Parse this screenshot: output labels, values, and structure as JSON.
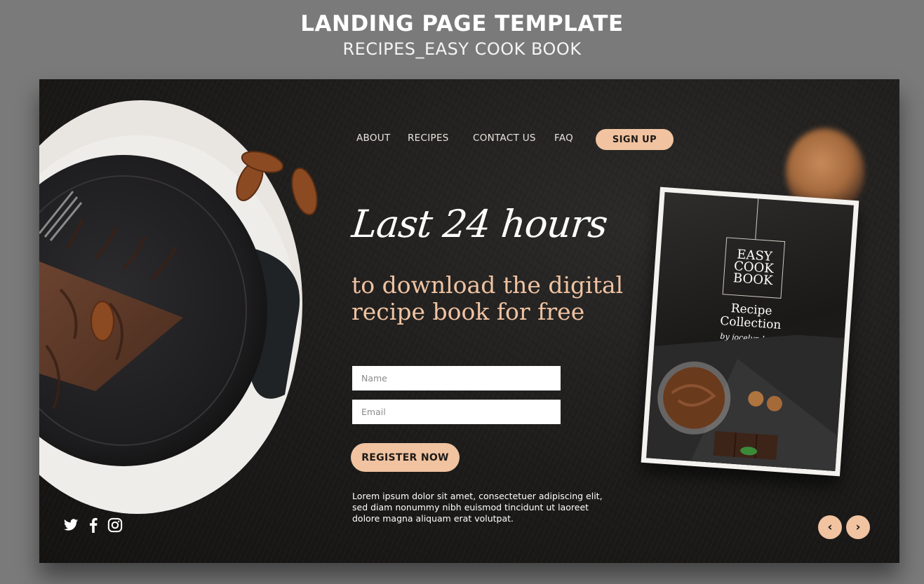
{
  "frame": {
    "title": "LANDING PAGE TEMPLATE",
    "subtitle": "RECIPES_EASY COOK BOOK"
  },
  "nav": {
    "items": [
      {
        "label": "ABOUT"
      },
      {
        "label": "RECIPES"
      },
      {
        "label": "CONTACT US"
      },
      {
        "label": "FAQ"
      }
    ],
    "signup_label": "SIGN UP"
  },
  "hero": {
    "script_title": "Last 24 hours",
    "subtitle_line1": "to download the digital",
    "subtitle_line2": "recipe book for free"
  },
  "form": {
    "name_placeholder": "Name",
    "email_placeholder": "Email",
    "register_label": "REGISTER NOW"
  },
  "body_text": "Lorem ipsum dolor sit amet, consectetuer adipiscing elit, sed diam nonummy nibh euismod tincidunt ut laoreet dolore magna aliquam erat volutpat.",
  "social": {
    "icons": [
      "twitter-icon",
      "facebook-icon",
      "instagram-icon"
    ]
  },
  "cookbook": {
    "title_line1": "EASY",
    "title_line2": "COOK",
    "title_line3": "BOOK",
    "collection_line1": "Recipe",
    "collection_line2": "Collection",
    "author": "by jocelyn luna"
  },
  "carousel": {
    "prev_icon": "chevron-left-icon",
    "next_icon": "chevron-right-icon",
    "prev_glyph": "‹",
    "next_glyph": "›"
  },
  "colors": {
    "accent": "#f1c3a0",
    "background": "#1c1b1a",
    "frame": "#7a7a7a"
  }
}
